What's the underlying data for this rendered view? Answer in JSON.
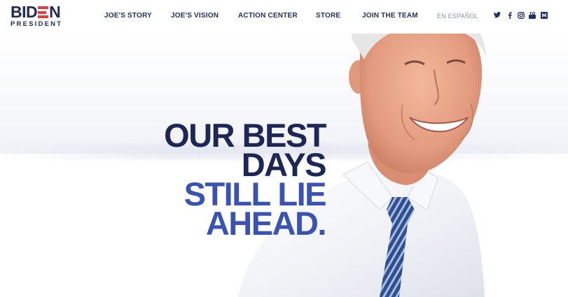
{
  "logo": {
    "word_left": "BID",
    "word_right": "N",
    "subtitle": "PRESIDENT"
  },
  "nav": {
    "items": [
      {
        "label": "JOE'S STORY"
      },
      {
        "label": "JOE'S VISION"
      },
      {
        "label": "ACTION CENTER"
      },
      {
        "label": "STORE"
      },
      {
        "label": "JOIN THE TEAM"
      },
      {
        "label": "EN ESPAÑOL"
      }
    ]
  },
  "social": [
    "twitter-icon",
    "facebook-icon",
    "instagram-icon",
    "youtube-icon",
    "medium-icon"
  ],
  "headline": {
    "line1": "OUR BEST",
    "line2": "DAYS",
    "line3": "STILL LIE",
    "line4": "AHEAD."
  },
  "colors": {
    "navy": "#1c2756",
    "blue": "#3a53b3",
    "red": "#e0403a"
  }
}
